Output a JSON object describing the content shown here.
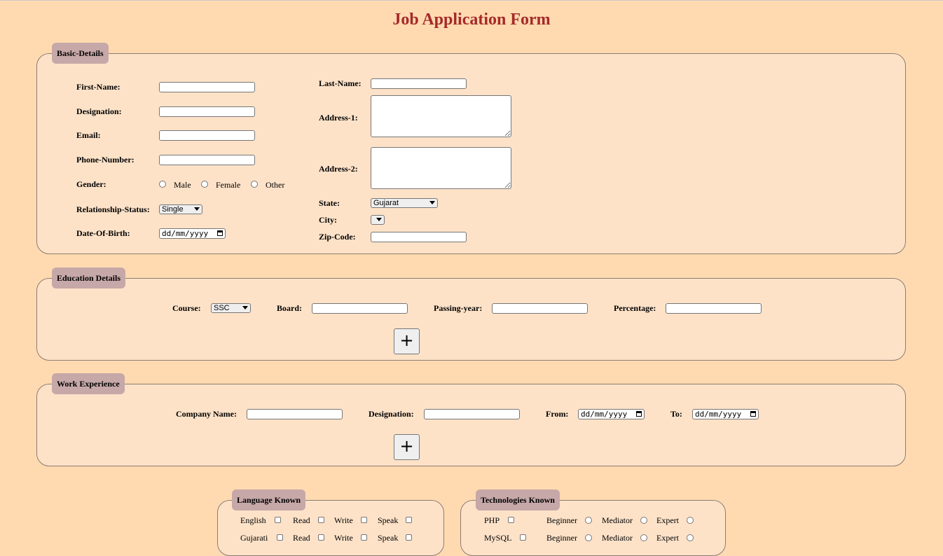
{
  "title": "Job Application Form",
  "basic": {
    "legend": "Basic-Details",
    "first_name": "First-Name:",
    "designation": "Designation:",
    "email": "Email:",
    "phone": "Phone-Number:",
    "gender": "Gender:",
    "gender_options": [
      "Male",
      "Female",
      "Other"
    ],
    "relationship": "Relationship-Status:",
    "relationship_value": "Single",
    "dob": "Date-Of-Birth:",
    "date_placeholder": "dd/mm/yyyy",
    "last_name": "Last-Name:",
    "address1": "Address-1:",
    "address2": "Address-2:",
    "state": "State:",
    "state_value": "Gujarat",
    "city": "City:",
    "city_value": "",
    "zip": "Zip-Code:"
  },
  "education": {
    "legend": "Education Details",
    "course": "Course:",
    "course_value": "SSC",
    "board": "Board:",
    "passing_year": "Passing-year:",
    "percentage": "Percentage:",
    "add_label": "+"
  },
  "work": {
    "legend": "Work Experience",
    "company": "Company Name:",
    "designation": "Designation:",
    "from": "From:",
    "to": "To:",
    "date_placeholder": "dd/mm/yyyy",
    "add_label": "+"
  },
  "language": {
    "legend": "Language Known",
    "rows": [
      {
        "name": "English",
        "read": "Read",
        "write": "Write",
        "speak": "Speak"
      },
      {
        "name": "Gujarati",
        "read": "Read",
        "write": "Write",
        "speak": "Speak"
      }
    ]
  },
  "technology": {
    "legend": "Technologies Known",
    "rows": [
      {
        "name": "PHP",
        "levels": [
          "Beginner",
          "Mediator",
          "Expert"
        ]
      },
      {
        "name": "MySQL",
        "levels": [
          "Beginner",
          "Mediator",
          "Expert"
        ]
      }
    ]
  }
}
